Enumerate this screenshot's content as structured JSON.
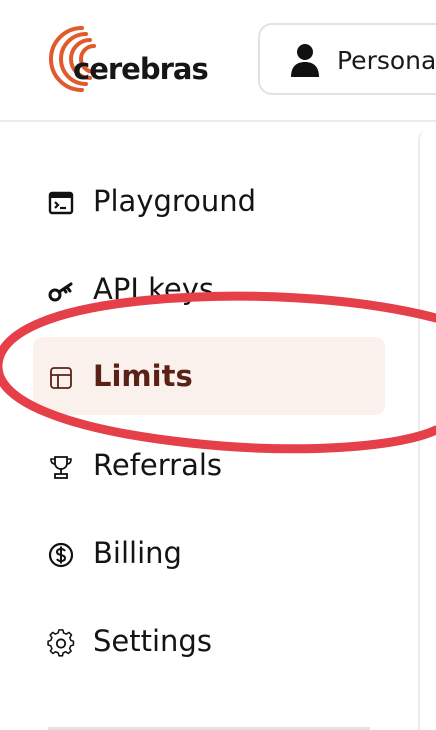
{
  "brand": {
    "name": "cerebras",
    "logo_color": "#e05a2b"
  },
  "header": {
    "account_label": "Personal",
    "account_icon": "person-icon"
  },
  "sidebar": {
    "items": [
      {
        "label": "Playground",
        "icon": "terminal-window-icon",
        "active": false
      },
      {
        "label": "API keys",
        "icon": "key-icon",
        "active": false
      },
      {
        "label": "Limits",
        "icon": "table-icon",
        "active": true
      },
      {
        "label": "Referrals",
        "icon": "trophy-icon",
        "active": false
      },
      {
        "label": "Billing",
        "icon": "dollar-circle-icon",
        "active": false
      },
      {
        "label": "Settings",
        "icon": "gear-icon",
        "active": false
      }
    ]
  },
  "colors": {
    "active_bg": "#fbf1ec",
    "active_text": "#5a2216",
    "annotation_red": "#e5404a"
  }
}
